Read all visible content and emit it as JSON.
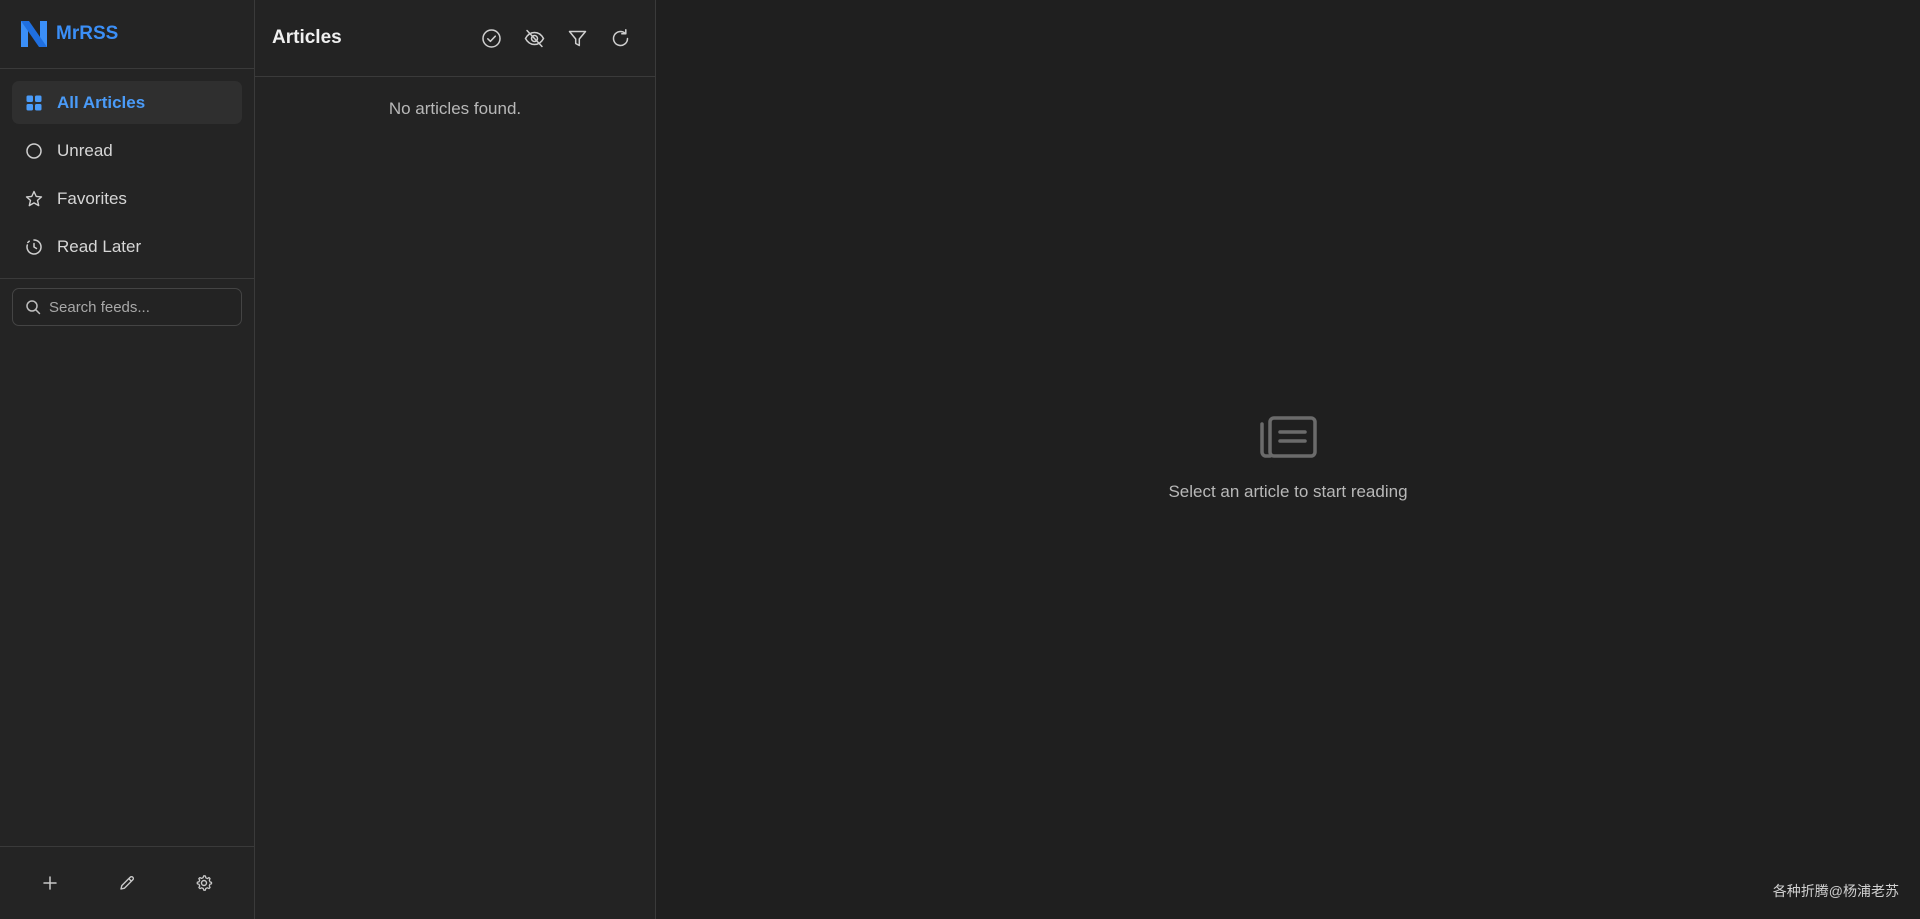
{
  "brand": {
    "name": "MrRSS",
    "logo_icon": "mrrss-n-logo",
    "accent": "#3b8ff7"
  },
  "sidebar": {
    "nav": [
      {
        "label": "All Articles",
        "icon": "grid-icon",
        "active": true
      },
      {
        "label": "Unread",
        "icon": "circle-icon",
        "active": false
      },
      {
        "label": "Favorites",
        "icon": "star-icon",
        "active": false
      },
      {
        "label": "Read Later",
        "icon": "clock-icon",
        "active": false
      }
    ],
    "search": {
      "placeholder": "Search feeds...",
      "value": ""
    },
    "footer": [
      {
        "icon": "plus-icon"
      },
      {
        "icon": "pencil-icon"
      },
      {
        "icon": "gear-icon"
      }
    ]
  },
  "articles": {
    "title": "Articles",
    "tools": [
      "check-circle-icon",
      "eye-off-icon",
      "filter-icon",
      "refresh-icon"
    ],
    "empty_text": "No articles found."
  },
  "reader": {
    "empty_icon": "newspaper-icon",
    "empty_text": "Select an article to start reading"
  },
  "watermark": "各种折腾@杨浦老苏",
  "colors": {
    "background": "#1f1f1f",
    "sidebar": "#242424",
    "active_item": "#2f2f2f",
    "active_text": "#4a9bf8",
    "border": "#3a3a3a"
  }
}
